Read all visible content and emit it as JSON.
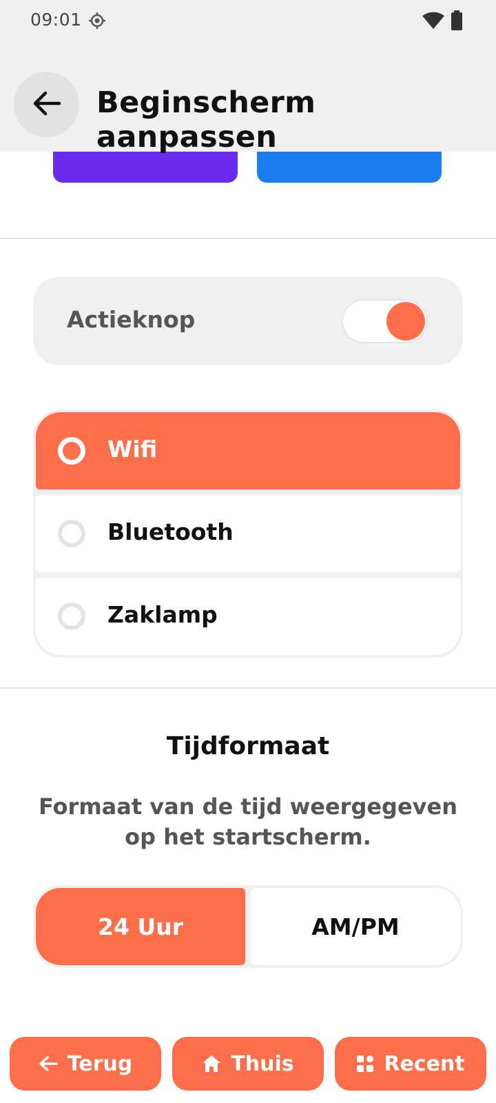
{
  "status_bar": {
    "time": "09:01",
    "icons": [
      "gps-icon",
      "wifi-icon",
      "battery-icon"
    ]
  },
  "header": {
    "title": "Beginscherm aanpassen",
    "back_icon": "arrow-left-icon"
  },
  "colors": {
    "accent": "#ff6e4a",
    "tile_purple": "#6c2cf0",
    "tile_blue": "#1a7ef0",
    "card_bg": "#f0f0f0"
  },
  "action_button": {
    "label": "Actieknop",
    "enabled": true
  },
  "action_options": {
    "selected": "Wifi",
    "items": [
      {
        "label": "Wifi",
        "selected": true
      },
      {
        "label": "Bluetooth",
        "selected": false
      },
      {
        "label": "Zaklamp",
        "selected": false
      }
    ]
  },
  "time_format": {
    "title": "Tijdformaat",
    "description": "Formaat van de tijd weergegeven op het startscherm.",
    "selected": "24 Uur",
    "options": [
      "24 Uur",
      "AM/PM"
    ]
  },
  "bottom_nav": {
    "back_label": "Terug",
    "home_label": "Thuis",
    "recent_label": "Recent",
    "icons": [
      "arrow-left-icon",
      "home-icon",
      "grid-icon"
    ]
  }
}
